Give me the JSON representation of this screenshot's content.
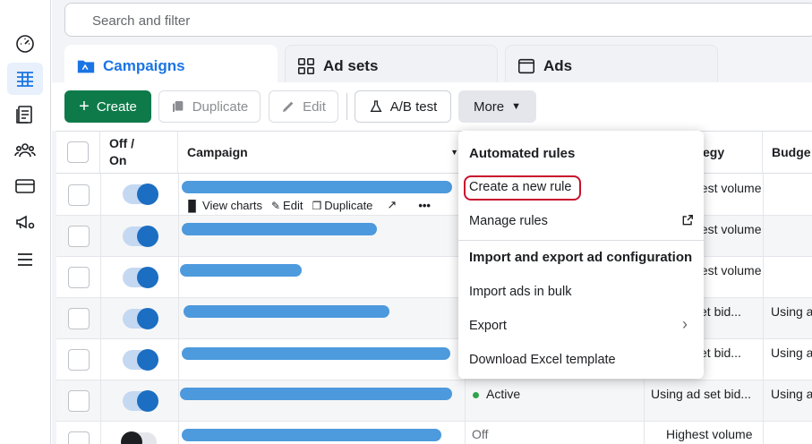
{
  "search": {
    "placeholder": "Search and filter"
  },
  "tabs": [
    {
      "label": "Campaigns",
      "icon": "campaign-folder-icon"
    },
    {
      "label": "Ad sets",
      "icon": "grid-icon"
    },
    {
      "label": "Ads",
      "icon": "ad-window-icon"
    }
  ],
  "toolbar": {
    "create": "Create",
    "duplicate": "Duplicate",
    "edit": "Edit",
    "ab_test": "A/B test",
    "more": "More"
  },
  "table": {
    "headers": {
      "off_on": "Off / On",
      "campaign": "Campaign",
      "bid_strategy": "egy",
      "budget": "Budge"
    },
    "row_actions": {
      "view_charts": "View charts",
      "edit": "Edit",
      "duplicate": "Duplicate"
    },
    "rows": [
      {
        "status": "",
        "bid_strategy": "hest volume",
        "budget": ""
      },
      {
        "status": "",
        "bid_strategy": "hest volume",
        "budget": ""
      },
      {
        "status": "",
        "bid_strategy": "hest volume",
        "budget": ""
      },
      {
        "status": "",
        "bid_strategy": "set bid...",
        "budget": "Using a"
      },
      {
        "status": "",
        "bid_strategy": "set bid...",
        "budget": "Using a"
      },
      {
        "status": "Active",
        "bid_strategy": "Using ad set bid...",
        "budget": "Using a"
      },
      {
        "status": "Off",
        "bid_strategy": "Highest volume",
        "budget": ""
      }
    ]
  },
  "more_menu": {
    "automated_rules_heading": "Automated rules",
    "create_rule": "Create a new rule",
    "manage_rules": "Manage rules",
    "import_export_heading": "Import and export ad configuration",
    "import_bulk": "Import ads in bulk",
    "export": "Export",
    "download_template": "Download Excel template"
  },
  "colors": {
    "accent": "#1b74e4",
    "create": "#0e7a4a",
    "highlight": "#c8102e"
  }
}
